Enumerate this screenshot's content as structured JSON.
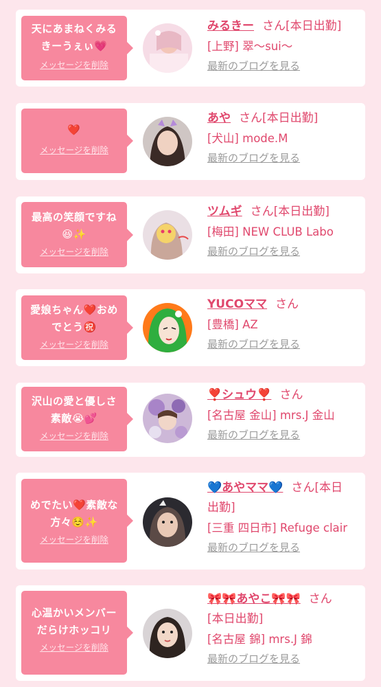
{
  "delete_label": "メッセージを削除",
  "blog_label": "最新のブログを見る",
  "san": "さん",
  "cards": [
    {
      "message_1": "天にあまねくみる",
      "message_2": "きーうぇぃ💗",
      "name": "みるきー",
      "suffix": "さん[本日出勤]",
      "shop": "[上野] 翠〜sui〜"
    },
    {
      "message_1": "❤️",
      "message_2": "",
      "name": "あや",
      "suffix": "さん[本日出勤]",
      "shop": "[犬山] mode.M"
    },
    {
      "message_1": "最高の笑顔ですね",
      "message_2": "😆✨",
      "name": "ツムギ",
      "suffix": "さん[本日出勤]",
      "shop": "[梅田] NEW CLUB Labo"
    },
    {
      "message_1": "愛娘ちゃん❤️おめ",
      "message_2": "でとう㊗️",
      "name": "YUCOママ",
      "suffix": "さん",
      "shop": "[豊橋] AZ"
    },
    {
      "message_1": "沢山の愛と優しさ",
      "message_2": "素敵😭💕",
      "name": "❣️シュウ❣️",
      "suffix": "さん",
      "shop": "[名古屋 金山] mrs.J 金山"
    },
    {
      "message_1": "めでたい❤️素敵な",
      "message_2": "方々☺️✨",
      "name": "💙あやママ💙",
      "suffix_1": "さん[本日",
      "suffix_2": "出勤]",
      "shop": "[三重 四日市] Refuge clair"
    },
    {
      "message_1": "心温かいメンバー",
      "message_2": "だらけホッコリ",
      "name": "🎀🎀あやこ🎀🎀",
      "suffix": "さん",
      "today": "[本日出勤]",
      "shop": "[名古屋 錦] mrs.J 錦"
    }
  ],
  "colors": {
    "bubble": "#f7889e",
    "accent": "#e0486d",
    "background": "#fde6ec",
    "link_gray": "#9b9b9b"
  }
}
